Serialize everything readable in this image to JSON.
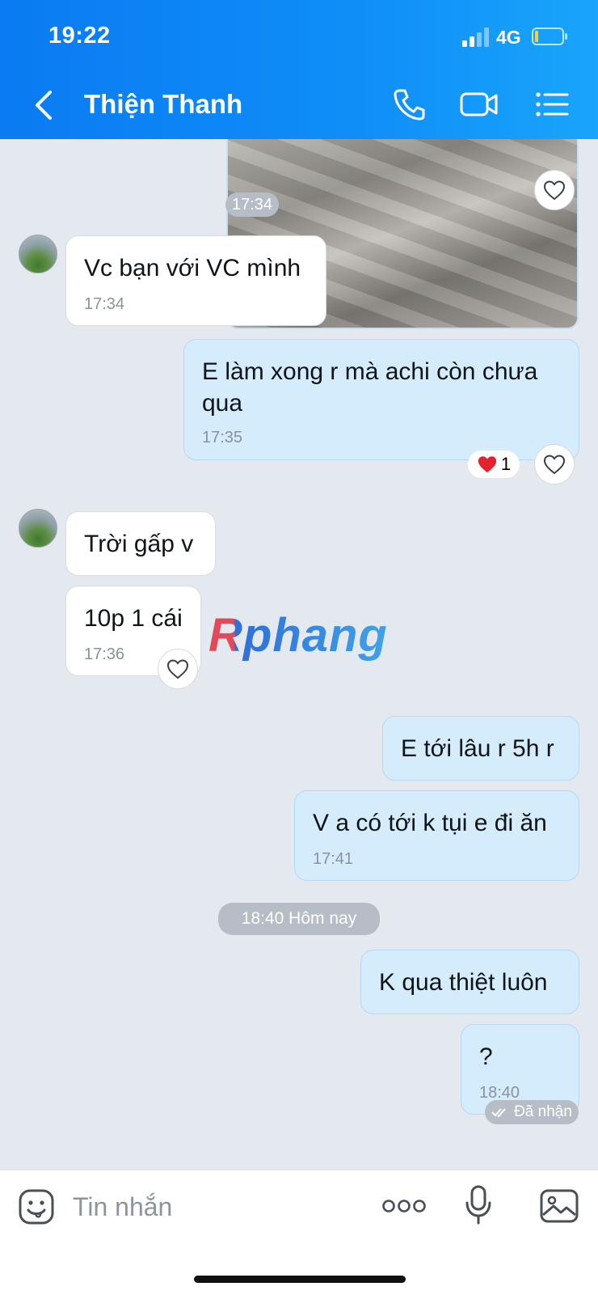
{
  "status_bar": {
    "time": "19:22",
    "network": "4G"
  },
  "header": {
    "contact_name": "Thiện Thanh"
  },
  "messages": [
    {
      "id": "img",
      "time": "17:34"
    },
    {
      "id": "m1",
      "text": "Vc bạn với VC mình",
      "time": "17:34"
    },
    {
      "id": "m2",
      "text": "E làm xong r mà achi còn chưa qua",
      "time": "17:35",
      "reaction_count": "1"
    },
    {
      "id": "m3",
      "text": "Trời gấp v"
    },
    {
      "id": "m4",
      "text": "10p 1 cái",
      "time": "17:36"
    },
    {
      "id": "m5",
      "text": "E tới lâu r 5h r"
    },
    {
      "id": "m6",
      "text": "V a có tới k tụi e đi ăn",
      "time": "17:41"
    },
    {
      "id": "m7",
      "text": "K qua thiệt luôn"
    },
    {
      "id": "m8",
      "text": "?",
      "time": "18:40"
    }
  ],
  "date_divider": "18:40 Hôm nay",
  "seen_status": "Đã nhận",
  "watermark": "Rphang",
  "input": {
    "placeholder": "Tin nhắn",
    "value": ""
  },
  "colors": {
    "header": "#0f8ef8",
    "outgoing_bubble": "#d5ecfd",
    "incoming_bubble": "#ffffff",
    "background": "#e4e8ef",
    "reaction_heart": "#e5232f"
  },
  "icons": [
    "back-icon",
    "phone-icon",
    "video-call-icon",
    "menu-list-icon",
    "heart-outline-icon",
    "heart-icon",
    "emoji-icon",
    "more-dots-icon",
    "microphone-icon",
    "image-icon",
    "double-check-icon"
  ]
}
